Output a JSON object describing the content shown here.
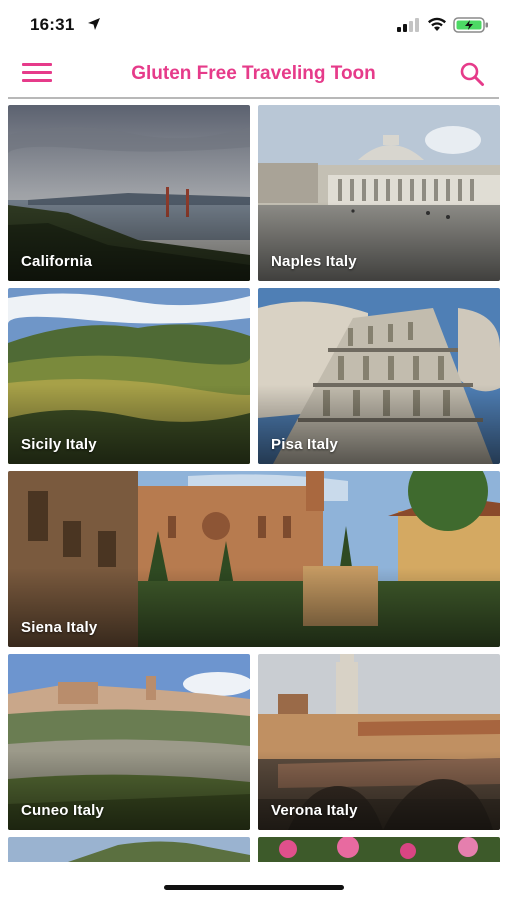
{
  "status_bar": {
    "time": "16:31"
  },
  "header": {
    "title": "Gluten Free Traveling Toon",
    "title_color": "#e63b8a"
  },
  "destinations": [
    {
      "label": "California"
    },
    {
      "label": "Naples Italy"
    },
    {
      "label": "Sicily Italy"
    },
    {
      "label": "Pisa Italy"
    },
    {
      "label": "Siena Italy"
    },
    {
      "label": "Cuneo Italy"
    },
    {
      "label": "Verona Italy"
    }
  ],
  "icons": {
    "menu": "menu-icon",
    "search": "search-icon",
    "location": "location-arrow-icon",
    "signal": "signal-icon",
    "wifi": "wifi-icon",
    "battery": "battery-charging-icon"
  }
}
